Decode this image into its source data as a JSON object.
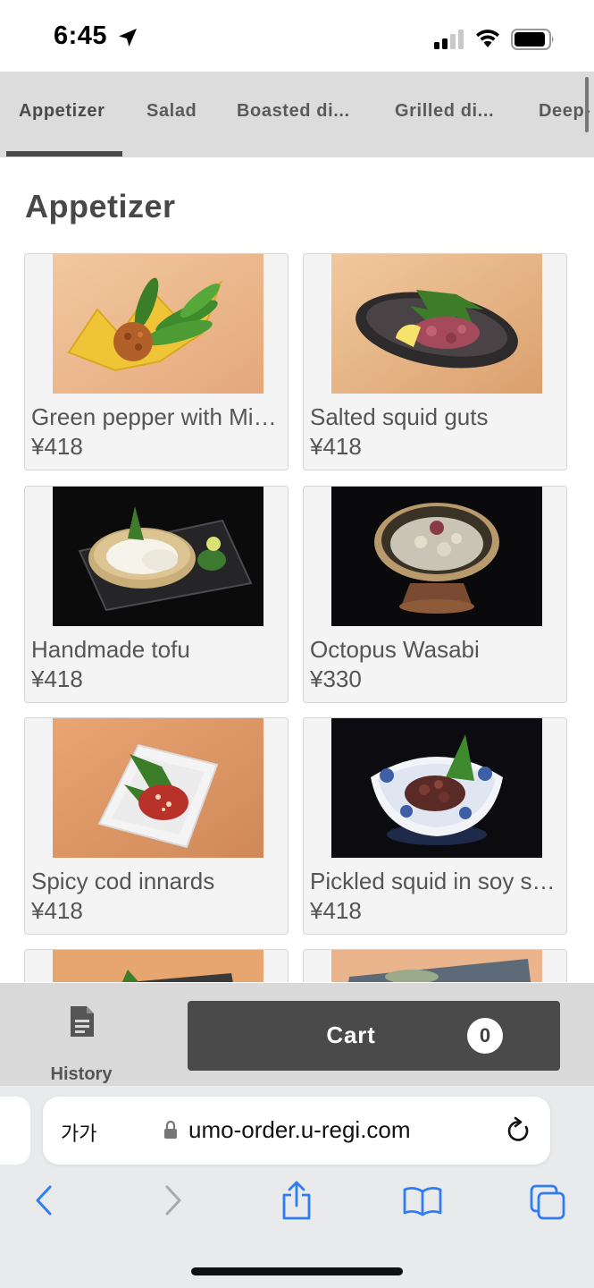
{
  "status_bar": {
    "time": "6:45"
  },
  "tabs": [
    {
      "label": "Appetizer",
      "active": true
    },
    {
      "label": "Salad",
      "active": false
    },
    {
      "label": "Boasted di...",
      "active": false
    },
    {
      "label": "Grilled di...",
      "active": false
    },
    {
      "label": "Deep-",
      "active": false
    }
  ],
  "section": {
    "title": "Appetizer"
  },
  "menu_items": [
    {
      "name": "Green pepper with Mis…",
      "price": "¥418"
    },
    {
      "name": "Salted squid guts",
      "price": "¥418"
    },
    {
      "name": "Handmade tofu",
      "price": "¥418"
    },
    {
      "name": "Octopus Wasabi",
      "price": "¥330"
    },
    {
      "name": "Spicy cod innards",
      "price": "¥418"
    },
    {
      "name": "Pickled squid in soy s…",
      "price": "¥418"
    }
  ],
  "footer": {
    "history_label": "History",
    "cart_label": "Cart",
    "cart_count": "0"
  },
  "browser": {
    "text_size_button": "가가",
    "url": "umo-order.u-regi.com"
  },
  "colors": {
    "tab_bar": "#dcdcdc",
    "active_indicator": "#4a4a4a",
    "cart_button": "#4a4a4a",
    "card_background": "#f4f4f4",
    "ios_blue": "#2f7cf6"
  }
}
